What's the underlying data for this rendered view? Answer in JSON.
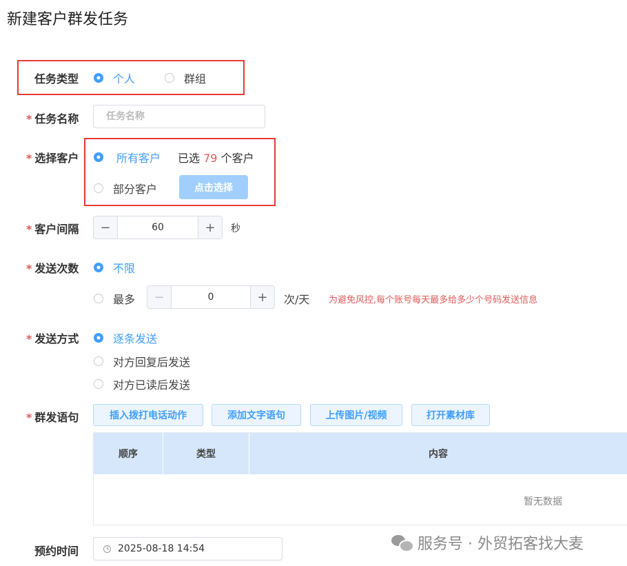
{
  "page": {
    "title": "新建客户群发任务"
  },
  "task_type": {
    "label": "任务类型",
    "options": [
      {
        "label": "个人",
        "checked": true
      },
      {
        "label": "群组",
        "checked": false
      }
    ]
  },
  "task_name": {
    "label": "任务名称",
    "placeholder": "任务名称"
  },
  "select_customer": {
    "label": "选择客户",
    "all_label": "所有客户",
    "selected_prefix": "已选",
    "selected_count": "79",
    "selected_suffix": "个客户",
    "partial_label": "部分客户",
    "select_button": "点击选择"
  },
  "interval": {
    "label": "客户间隔",
    "value": "60",
    "unit": "秒",
    "minus": "−",
    "plus": "+"
  },
  "send_count": {
    "label": "发送次数",
    "unlimited_label": "不限",
    "max_label": "最多",
    "value": "0",
    "unit": "次/天",
    "minus": "−",
    "plus": "+",
    "hint": "为避免风控,每个账号每天最多给多少个号码发送信息"
  },
  "send_method": {
    "label": "发送方式",
    "options": [
      {
        "label": "逐条发送",
        "checked": true
      },
      {
        "label": "对方回复后发送",
        "checked": false
      },
      {
        "label": "对方已读后发送",
        "checked": false
      }
    ]
  },
  "messages": {
    "label": "群发语句",
    "buttons": [
      "插入拨打电话动作",
      "添加文字语句",
      "上传图片/视频",
      "打开素材库"
    ],
    "columns": [
      "顺序",
      "类型",
      "内容"
    ],
    "empty": "暂无数据"
  },
  "schedule": {
    "label": "预约时间",
    "value": "2025-08-18 14:54"
  },
  "watermark": {
    "text": "服务号 · 外贸拓客找大麦"
  },
  "colors": {
    "primary": "#409eff",
    "required": "#e05a5a",
    "highlight": "#e53935",
    "table_header": "#d6e7fb"
  }
}
